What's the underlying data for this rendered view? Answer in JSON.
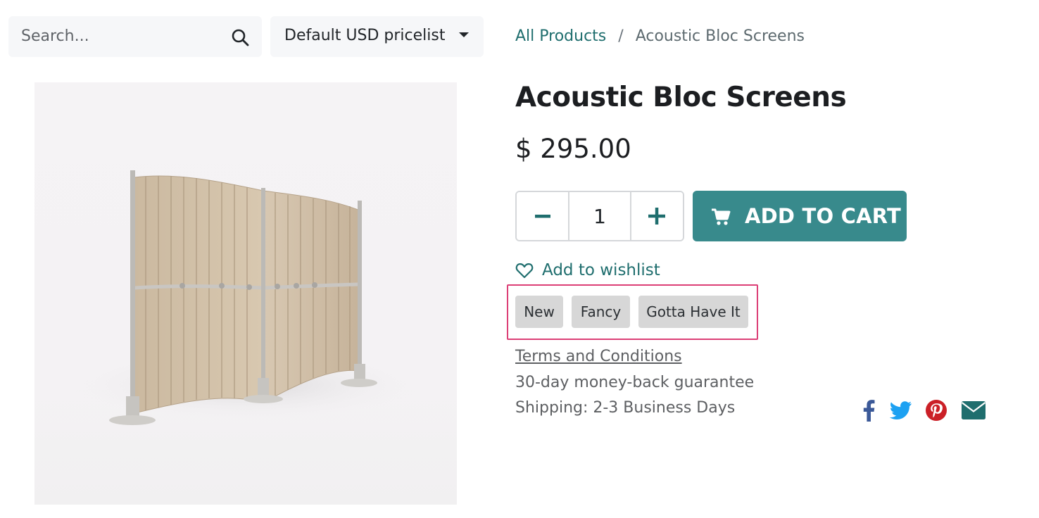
{
  "search": {
    "placeholder": "Search...",
    "icon": "search-icon"
  },
  "pricelist": {
    "label": "Default USD pricelist",
    "icon": "caret-down-icon"
  },
  "breadcrumb": {
    "parent": "All Products",
    "separator": "/",
    "current": "Acoustic Bloc Screens"
  },
  "product": {
    "title": "Acoustic Bloc Screens",
    "price": "$ 295.00",
    "image": "acoustic-bloc-screens-product-image"
  },
  "quantity": {
    "value": "1",
    "minus_icon": "minus-icon",
    "plus_icon": "plus-icon"
  },
  "add_to_cart": {
    "label": "ADD TO CART",
    "icon": "shopping-cart-icon"
  },
  "wishlist": {
    "label": "Add to wishlist",
    "icon": "heart-outline-icon"
  },
  "tags": [
    "New",
    "Fancy",
    "Gotta Have It"
  ],
  "info": {
    "terms": "Terms and Conditions",
    "guarantee": "30-day money-back guarantee",
    "shipping": "Shipping: 2-3 Business Days"
  },
  "share": [
    {
      "name": "facebook-icon",
      "color": "#3b5998"
    },
    {
      "name": "twitter-icon",
      "color": "#1da1f2"
    },
    {
      "name": "pinterest-icon",
      "color": "#cb2027"
    },
    {
      "name": "email-icon",
      "color": "#1f6e6e"
    }
  ],
  "colors": {
    "accent": "#388a8c",
    "link": "#1f6e6e",
    "highlight_border": "#dc3f76",
    "tag_bg": "#d7d7d7"
  }
}
